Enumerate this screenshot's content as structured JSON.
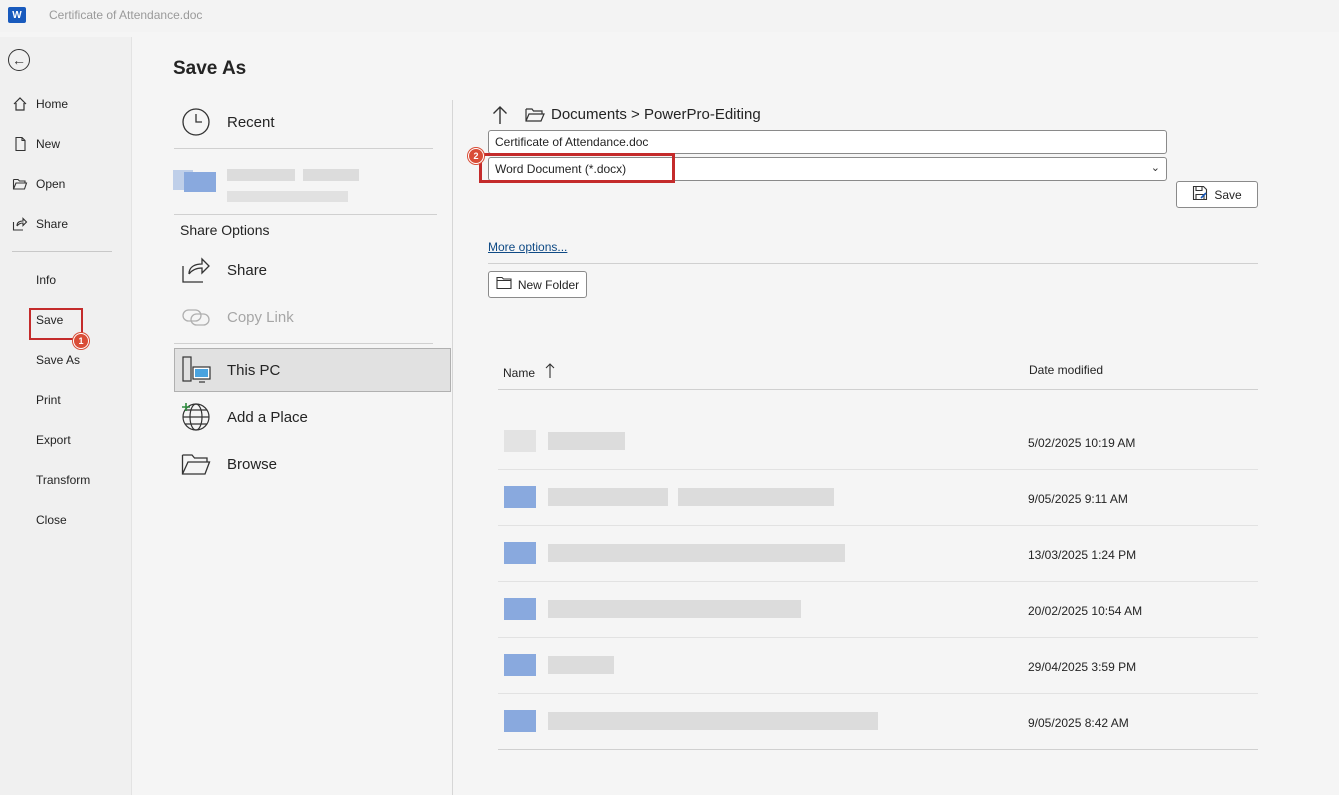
{
  "window": {
    "title": "Certificate of Attendance.doc",
    "app_logo_letter": "W"
  },
  "nav": {
    "items": [
      {
        "label": "Home",
        "icon": "home-icon"
      },
      {
        "label": "New",
        "icon": "new-document-icon"
      },
      {
        "label": "Open",
        "icon": "open-folder-icon"
      },
      {
        "label": "Share",
        "icon": "share-icon"
      }
    ],
    "text_items": [
      "Info",
      "Save",
      "Save As",
      "Print",
      "Export",
      "Transform",
      "Close"
    ],
    "badge_save_as": "1"
  },
  "page": {
    "title": "Save As"
  },
  "locations": {
    "recent": "Recent",
    "share_options_heading": "Share Options",
    "share": "Share",
    "copy_link": "Copy Link",
    "this_pc": "This PC",
    "add_place": "Add a Place",
    "browse": "Browse"
  },
  "save_panel": {
    "breadcrumb": "Documents > PowerPro-Editing",
    "file_name": "Certificate of Attendance.doc",
    "file_type": "Word Document (*.docx)",
    "badge_file_type": "2",
    "save_label": "Save",
    "more_options": "More options...",
    "new_folder": "New Folder",
    "col_name": "Name",
    "col_date": "Date modified",
    "files": [
      {
        "date": "5/02/2025 10:19 AM"
      },
      {
        "date": "9/05/2025 9:11 AM"
      },
      {
        "date": "13/03/2025 1:24 PM"
      },
      {
        "date": "20/02/2025 10:54 AM"
      },
      {
        "date": "29/04/2025 3:59 PM"
      },
      {
        "date": "9/05/2025 8:42 AM"
      }
    ]
  },
  "colors": {
    "accent": "#185abd",
    "highlight": "#c42b2b",
    "badge": "#d94d37",
    "link": "#0f4a85"
  }
}
